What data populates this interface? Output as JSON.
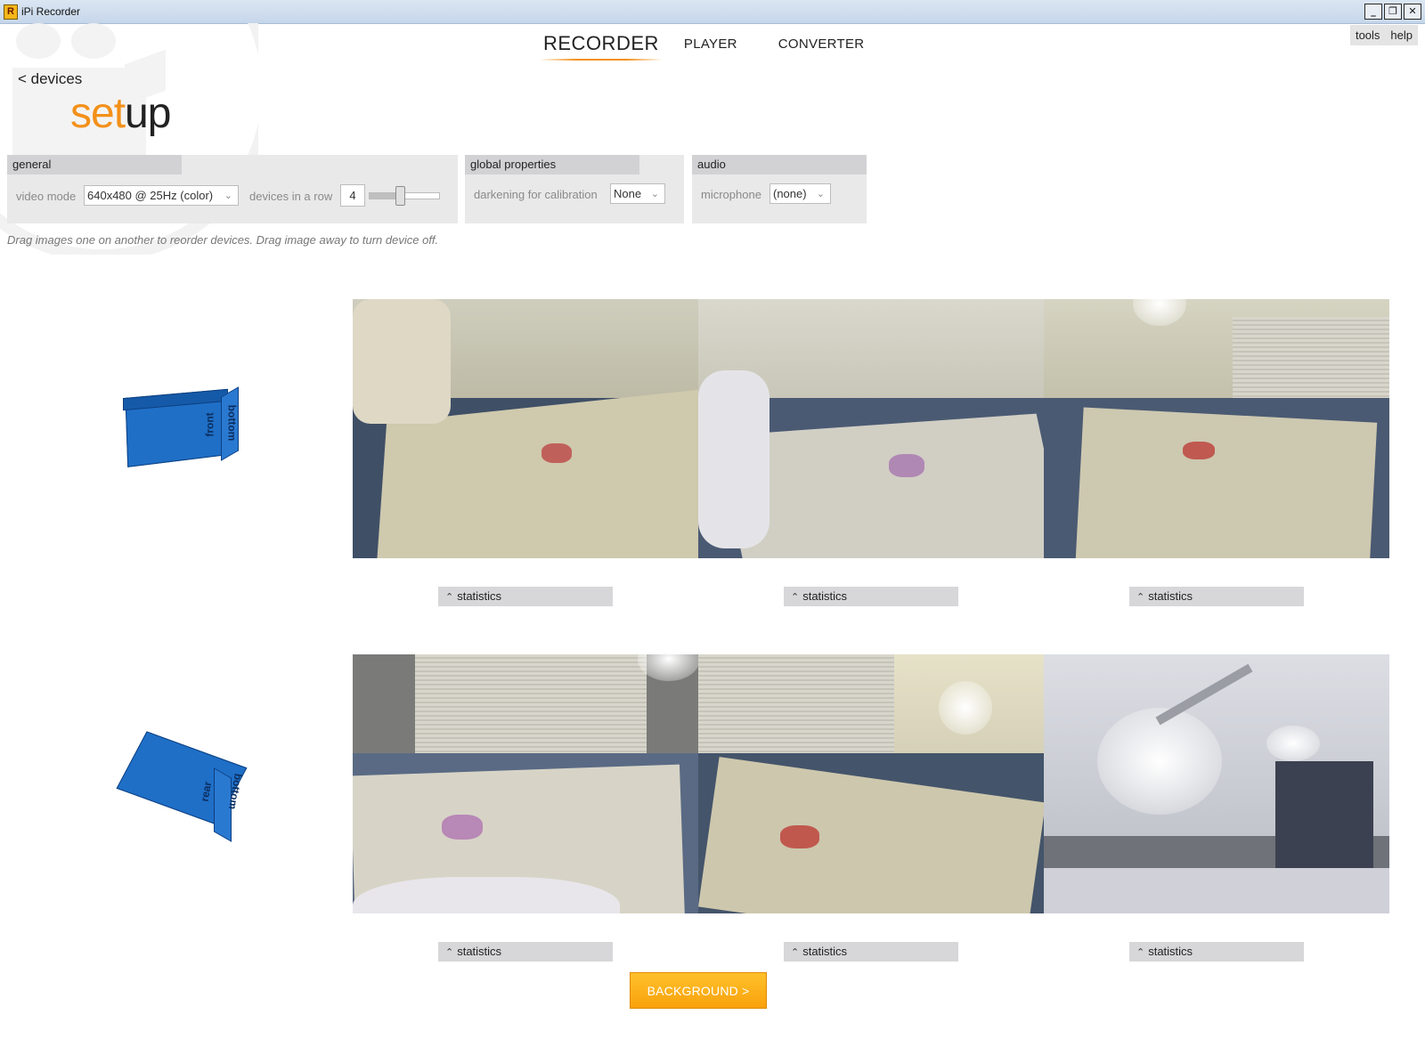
{
  "window": {
    "title": "iPi Recorder",
    "app_icon_letter": "R",
    "controls": [
      "_",
      "❐",
      "✕"
    ]
  },
  "nav": {
    "tabs": [
      "RECORDER",
      "PLAYER",
      "CONVERTER"
    ],
    "active": "RECORDER"
  },
  "top_right": {
    "tools": "tools",
    "help": "help"
  },
  "page": {
    "back_link": "< devices",
    "title_pre": "set",
    "title_post": "up"
  },
  "general": {
    "header": "general",
    "video_mode_label": "video mode",
    "video_mode_value": "640x480 @ 25Hz (color)",
    "devices_in_row_label": "devices in a row",
    "devices_in_row_value": "4",
    "devices_in_row_slider_fraction": 0.45
  },
  "global_properties": {
    "header": "global properties",
    "darkening_label": "darkening for calibration",
    "darkening_value": "None"
  },
  "audio": {
    "header": "audio",
    "microphone_label": "microphone",
    "microphone_value": "(none)"
  },
  "hint": "Drag images one on another to reorder devices. Drag image away to turn device off.",
  "devices": [
    {
      "orientation_labels": [
        "front",
        "bottom"
      ],
      "cameras": [
        {
          "statistics_label": "statistics"
        },
        {
          "statistics_label": "statistics"
        },
        {
          "statistics_label": "statistics"
        }
      ]
    },
    {
      "orientation_labels": [
        "rear",
        "bottom"
      ],
      "cameras": [
        {
          "statistics_label": "statistics"
        },
        {
          "statistics_label": "statistics"
        },
        {
          "statistics_label": "statistics"
        }
      ]
    }
  ],
  "buttons": {
    "background": "BACKGROUND >"
  },
  "colors": {
    "accent": "#f39019",
    "cube_blue": "#1f6fc7",
    "button_orange": "#f8a10c"
  }
}
